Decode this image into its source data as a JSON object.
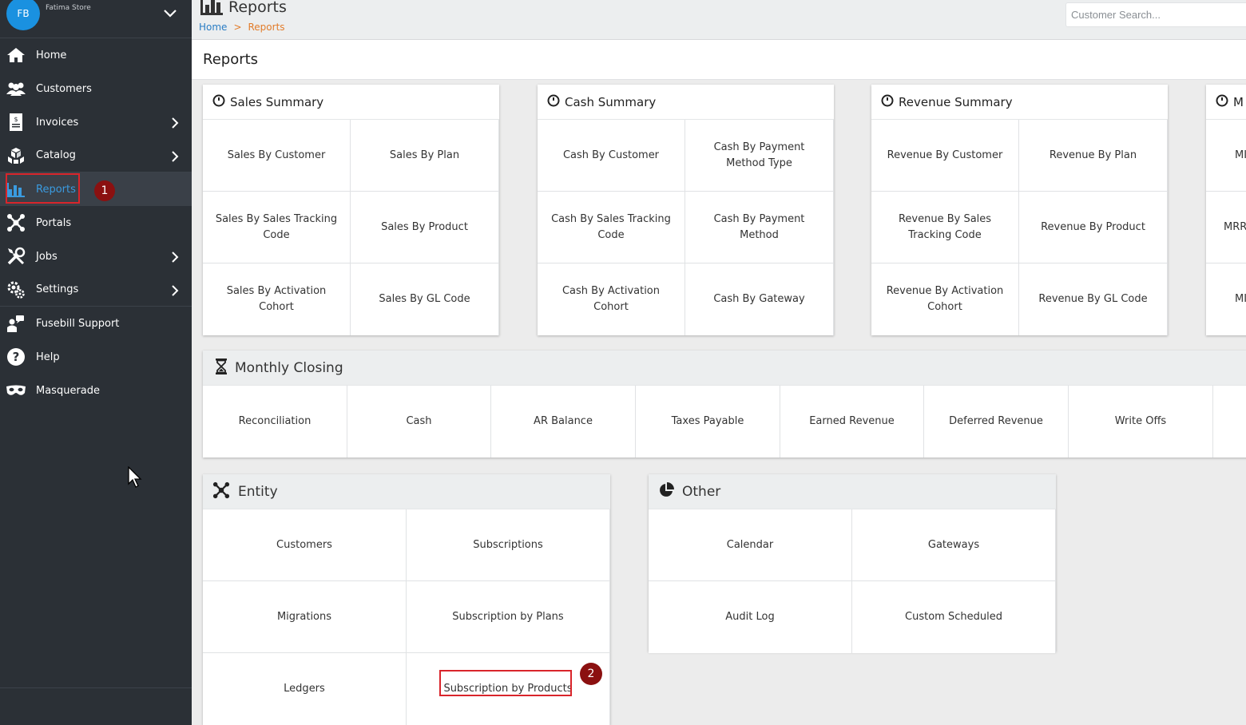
{
  "sidebar": {
    "avatar_initials": "FB",
    "store_name": "Fatima Store",
    "items": [
      {
        "label": "Home",
        "icon": "home-icon"
      },
      {
        "label": "Customers",
        "icon": "users-icon"
      },
      {
        "label": "Invoices",
        "icon": "invoice-icon"
      },
      {
        "label": "Catalog",
        "icon": "cubes-icon"
      },
      {
        "label": "Reports",
        "icon": "bar-chart-icon"
      },
      {
        "label": "Portals",
        "icon": "network-icon"
      },
      {
        "label": "Jobs",
        "icon": "tools-icon"
      },
      {
        "label": "Settings",
        "icon": "gears-icon"
      },
      {
        "label": "Fusebill Support",
        "icon": "support-icon"
      },
      {
        "label": "Help",
        "icon": "help-icon"
      },
      {
        "label": "Masquerade",
        "icon": "mask-icon"
      }
    ]
  },
  "annotations": {
    "step1": "1",
    "step2": "2"
  },
  "topbar": {
    "title": "Reports",
    "breadcrumb_home": "Home",
    "breadcrumb_sep": ">",
    "breadcrumb_current": "Reports",
    "search_placeholder": "Customer Search..."
  },
  "page": {
    "title": "Reports"
  },
  "sales_summary": {
    "title": "Sales Summary",
    "cells": [
      "Sales By Customer",
      "Sales By Plan",
      "Sales By Sales Tracking Code",
      "Sales By Product",
      "Sales By Activation Cohort",
      "Sales By GL Code"
    ]
  },
  "cash_summary": {
    "title": "Cash Summary",
    "cells": [
      "Cash By Customer",
      "Cash By Payment Method Type",
      "Cash By Sales Tracking Code",
      "Cash By Payment Method",
      "Cash By Activation Cohort",
      "Cash By Gateway"
    ]
  },
  "revenue_summary": {
    "title": "Revenue Summary",
    "cells": [
      "Revenue By Customer",
      "Revenue By Plan",
      "Revenue By Sales Tracking Code",
      "Revenue By Product",
      "Revenue By Activation Cohort",
      "Revenue By GL Code"
    ]
  },
  "fourth_card": {
    "title": "M",
    "cells": [
      "MI",
      "MRR",
      "MI"
    ]
  },
  "monthly_closing": {
    "title": "Monthly Closing",
    "cells": [
      "Reconciliation",
      "Cash",
      "AR Balance",
      "Taxes Payable",
      "Earned Revenue",
      "Deferred Revenue",
      "Write Offs"
    ]
  },
  "entity": {
    "title": "Entity",
    "cells": [
      "Customers",
      "Subscriptions",
      "Migrations",
      "Subscription by Plans",
      "Ledgers",
      "Subscription by Products"
    ]
  },
  "other": {
    "title": "Other",
    "cells": [
      "Calendar",
      "Gateways",
      "Audit Log",
      "Custom Scheduled"
    ]
  }
}
